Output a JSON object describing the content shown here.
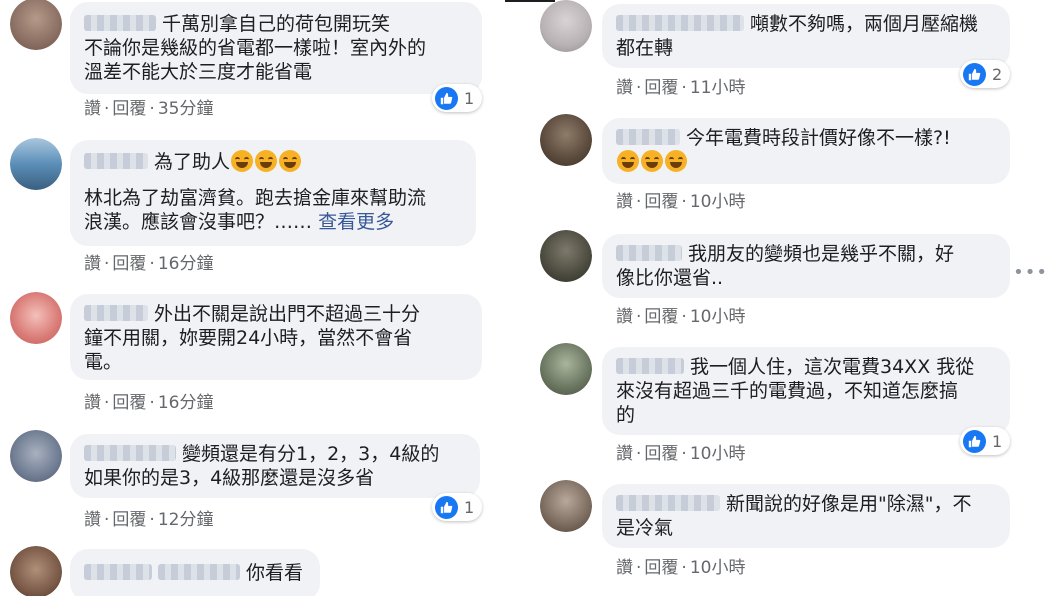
{
  "left_comments": [
    {
      "avatar_color": "#8a6a5c",
      "text_lines": [
        "千萬別拿自己的荷包開玩笑",
        "不論你是幾級的省電都一樣啦！室內外的",
        "溫差不能大於三度才能省電"
      ],
      "actions": {
        "like": "讚",
        "reply": "回覆",
        "time": "35分鐘"
      },
      "reaction_count": "1"
    },
    {
      "avatar_color": "#5b8fb8",
      "text_lines": [
        "為了助人",
        "",
        "林北為了劫富濟貧。跑去搶金庫來幫助流",
        "浪漢。應該會沒事吧？……"
      ],
      "see_more": "查看更多",
      "actions": {
        "like": "讚",
        "reply": "回覆",
        "time": "16分鐘"
      }
    },
    {
      "avatar_color": "#d97a76",
      "text_lines": [
        "外出不關是說出門不超過三十分",
        "鐘不用關，妳要開24小時，當然不會省",
        "電。"
      ],
      "actions": {
        "like": "讚",
        "reply": "回覆",
        "time": "16分鐘"
      }
    },
    {
      "avatar_color": "#6f7c92",
      "text_lines": [
        "變頻還是有分1，2，3，4級的",
        "如果你的是3，4級那麼還是沒多省"
      ],
      "actions": {
        "like": "讚",
        "reply": "回覆",
        "time": "12分鐘"
      },
      "reaction_count": "1"
    },
    {
      "avatar_color": "#7a5a48",
      "text_lines": [
        "你看看"
      ]
    }
  ],
  "right_comments": [
    {
      "avatar_color": "#b9b2b4",
      "text_lines": [
        "噸數不夠嗎，兩個月壓縮機",
        "都在轉"
      ],
      "actions": {
        "like": "讚",
        "reply": "回覆",
        "time": "11小時"
      },
      "reaction_count": "2"
    },
    {
      "avatar_color": "#5a4a3c",
      "text_lines": [
        "今年電費時段計價好像不一樣?!"
      ],
      "actions": {
        "like": "讚",
        "reply": "回覆",
        "time": "10小時"
      }
    },
    {
      "avatar_color": "#4b4a3e",
      "text_lines": [
        "我朋友的變頻也是幾乎不關，好",
        "像比你還省.."
      ],
      "actions": {
        "like": "讚",
        "reply": "回覆",
        "time": "10小時"
      }
    },
    {
      "avatar_color": "#6a7560",
      "text_lines": [
        "我一個人住，這次電費34XX 我從",
        "來沒有超過三千的電費過，不知道怎麼搞",
        "的"
      ],
      "actions": {
        "like": "讚",
        "reply": "回覆",
        "time": "10小時"
      },
      "reaction_count": "1"
    },
    {
      "avatar_color": "#7b6a5e",
      "text_lines": [
        "新聞說的好像是用\"除濕\"，不",
        "是冷氣"
      ],
      "actions": {
        "like": "讚",
        "reply": "回覆",
        "time": "10小時"
      }
    }
  ],
  "options_icon": "more-horizontal-icon",
  "like_color": "#1877f2",
  "link_color": "#385898"
}
